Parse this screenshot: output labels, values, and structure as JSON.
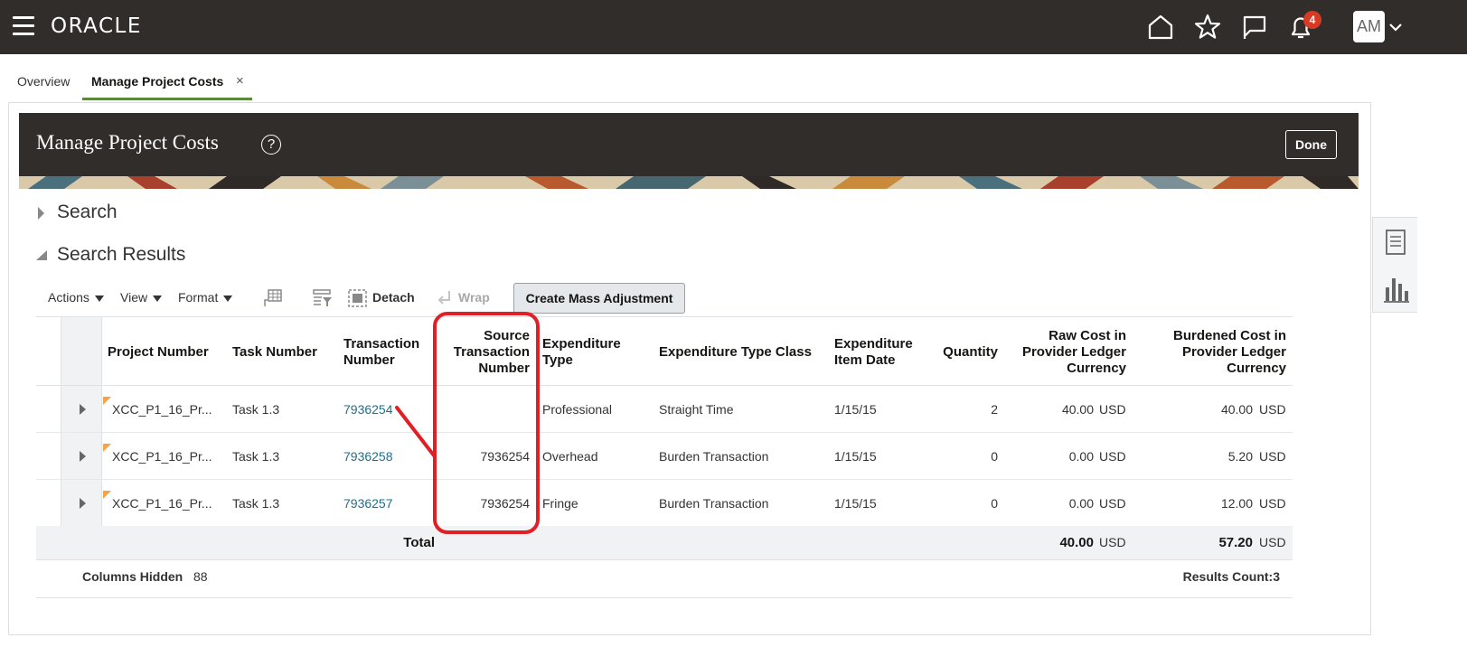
{
  "header": {
    "logo": "ORACLE",
    "notification_count": "4",
    "user_initials": "AM"
  },
  "tabs": {
    "overview": "Overview",
    "active": "Manage Project Costs",
    "close_glyph": "×"
  },
  "page": {
    "title": "Manage Project Costs",
    "help_glyph": "?",
    "done_label": "Done"
  },
  "sections": {
    "search": "Search",
    "results": "Search Results"
  },
  "toolbar": {
    "actions": "Actions",
    "view": "View",
    "format": "Format",
    "detach": "Detach",
    "wrap": "Wrap",
    "mass_adjust": "Create Mass Adjustment"
  },
  "table": {
    "headers": {
      "project_number": "Project Number",
      "task_number": "Task Number",
      "transaction_number_1": "Transaction",
      "transaction_number_2": "Number",
      "source_1": "Source",
      "source_2": "Transaction",
      "source_3": "Number",
      "exp_type_1": "Expenditure",
      "exp_type_2": "Type",
      "exp_type_class": "Expenditure Type Class",
      "exp_date_1": "Expenditure",
      "exp_date_2": "Item Date",
      "quantity": "Quantity",
      "raw_1": "Raw Cost in",
      "raw_2": "Provider Ledger",
      "raw_3": "Currency",
      "burdened_1": "Burdened Cost in",
      "burdened_2": "Provider Ledger",
      "burdened_3": "Currency"
    },
    "rows": [
      {
        "project": "XCC_P1_16_Pr...",
        "task": "Task 1.3",
        "txn": "7936254",
        "source": "",
        "exp_type": "Professional",
        "exp_class": "Straight Time",
        "date": "1/15/15",
        "qty": "2",
        "raw": "40.00",
        "raw_cur": "USD",
        "burdened": "40.00",
        "burdened_cur": "USD"
      },
      {
        "project": "XCC_P1_16_Pr...",
        "task": "Task 1.3",
        "txn": "7936258",
        "source": "7936254",
        "exp_type": "Overhead",
        "exp_class": "Burden Transaction",
        "date": "1/15/15",
        "qty": "0",
        "raw": "0.00",
        "raw_cur": "USD",
        "burdened": "5.20",
        "burdened_cur": "USD"
      },
      {
        "project": "XCC_P1_16_Pr...",
        "task": "Task 1.3",
        "txn": "7936257",
        "source": "7936254",
        "exp_type": "Fringe",
        "exp_class": "Burden Transaction",
        "date": "1/15/15",
        "qty": "0",
        "raw": "0.00",
        "raw_cur": "USD",
        "burdened": "12.00",
        "burdened_cur": "USD"
      }
    ],
    "total": {
      "label": "Total",
      "raw": "40.00",
      "raw_cur": "USD",
      "burdened": "57.20",
      "burdened_cur": "USD"
    },
    "footer": {
      "columns_hidden_label": "Columns Hidden",
      "columns_hidden_value": "88",
      "results_count": "Results Count:3"
    }
  },
  "colors": {
    "header_bg": "#312d2a",
    "link": "#1e6f8c",
    "highlight": "#e01f26",
    "tab_underline": "#5a8a3c",
    "badge": "#d63b25"
  }
}
